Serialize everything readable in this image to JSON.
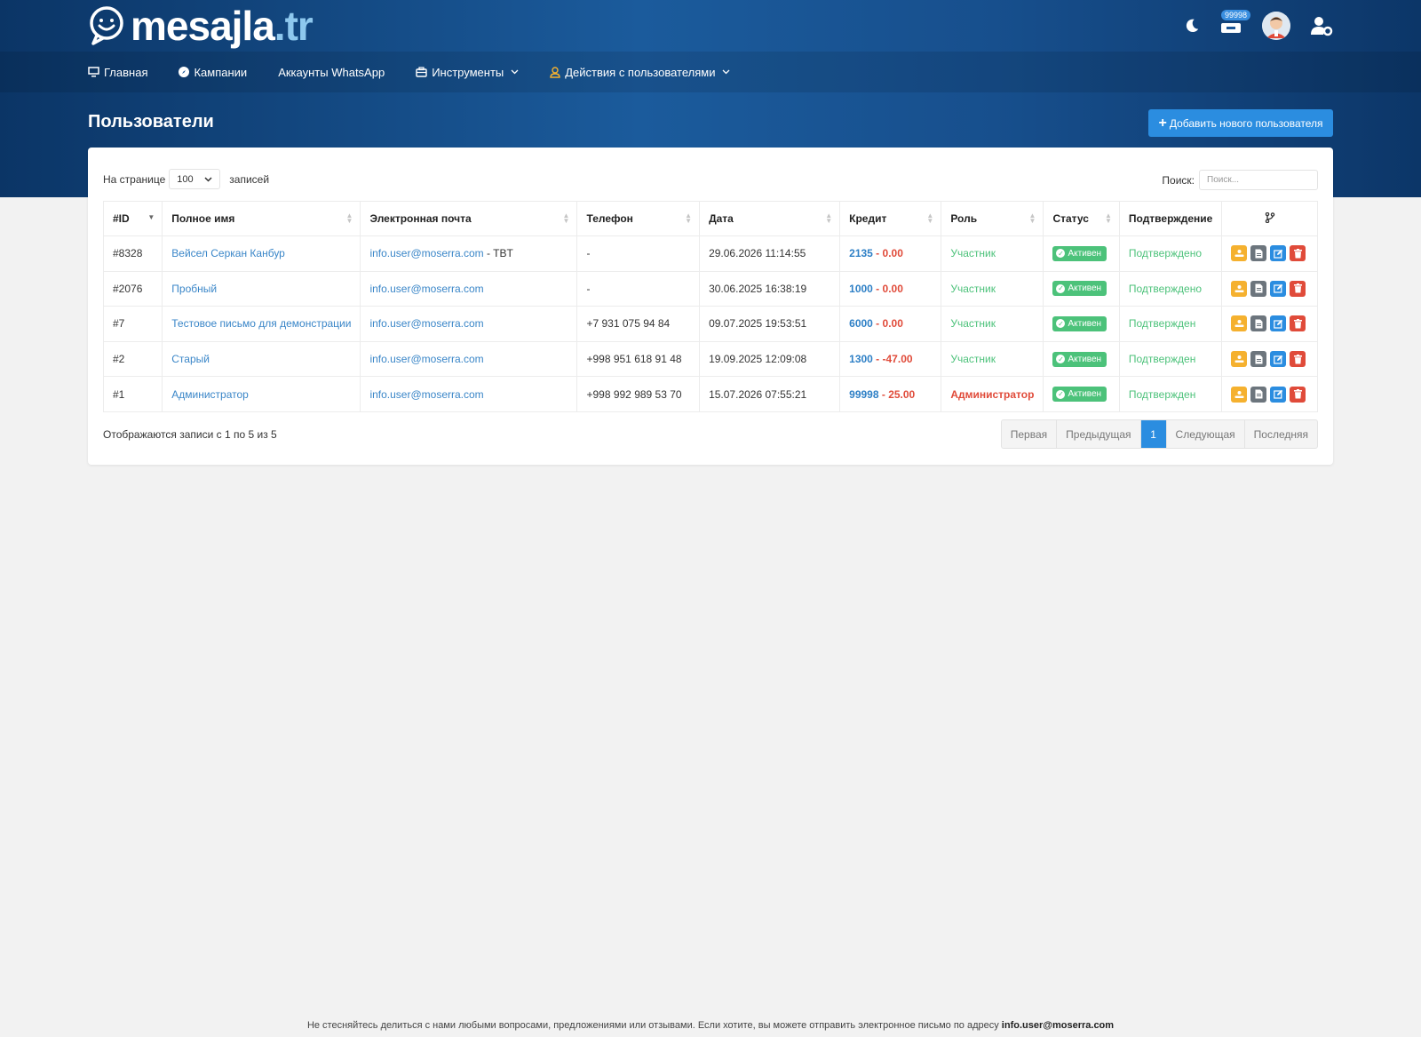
{
  "brand": {
    "name": "mesajla",
    "tld": ".tr"
  },
  "header": {
    "badge_count": "99998"
  },
  "nav": [
    {
      "label": "Главная",
      "icon": "monitor-icon"
    },
    {
      "label": "Кампании",
      "icon": "compass-icon"
    },
    {
      "label": "Аккаунты WhatsApp",
      "icon": ""
    },
    {
      "label": "Инструменты",
      "icon": "toolbox-icon",
      "dropdown": true
    },
    {
      "label": "Действия с пользователями",
      "icon": "user-icon",
      "dropdown": true
    }
  ],
  "page": {
    "title": "Пользователи",
    "add_button": "Добавить нового пользователя"
  },
  "length": {
    "prefix": "На странице",
    "value": "100",
    "suffix": "записей"
  },
  "search": {
    "label": "Поиск:",
    "placeholder": "Поиск..."
  },
  "table": {
    "columns": [
      "#ID",
      "Полное имя",
      "Электронная почта",
      "Телефон",
      "Дата",
      "Кредит",
      "Роль",
      "Статус",
      "Подтверждение"
    ],
    "rows": [
      {
        "id": "#8328",
        "name": "Вейсел Серкан Канбур",
        "email": "info.user@moserra.com",
        "email_suffix": " - TBT",
        "phone": "-",
        "date": "29.06.2026 11:14:55",
        "credit": "2135",
        "sep": " - ",
        "debt": "0.00",
        "role": "Участник",
        "status": "Активен",
        "confirm": "Подтверждено"
      },
      {
        "id": "#2076",
        "name": "Пробный",
        "email": "info.user@moserra.com",
        "email_suffix": "",
        "phone": "-",
        "date": "30.06.2025 16:38:19",
        "credit": "1000",
        "sep": " - ",
        "debt": "0.00",
        "role": "Участник",
        "status": "Активен",
        "confirm": "Подтверждено"
      },
      {
        "id": "#7",
        "name": "Тестовое письмо для демонстрации",
        "email": "info.user@moserra.com",
        "email_suffix": "",
        "phone": "+7 931 075 94 84",
        "date": "09.07.2025 19:53:51",
        "credit": "6000",
        "sep": " - ",
        "debt": "0.00",
        "role": "Участник",
        "status": "Активен",
        "confirm": "Подтвержден"
      },
      {
        "id": "#2",
        "name": "Старый",
        "email": "info.user@moserra.com",
        "email_suffix": "",
        "phone": "+998 951 618 91 48",
        "date": "19.09.2025 12:09:08",
        "credit": "1300",
        "sep": " - ",
        "debt": "-47.00",
        "role": "Участник",
        "status": "Активен",
        "confirm": "Подтвержден"
      },
      {
        "id": "#1",
        "name": "Администратор",
        "email": "info.user@moserra.com",
        "email_suffix": "",
        "phone": "+998 992 989 53 70",
        "date": "15.07.2026 07:55:21",
        "credit": "99998",
        "sep": " - ",
        "debt": "25.00",
        "role": "Администратор",
        "status": "Активен",
        "confirm": "Подтвержден"
      }
    ]
  },
  "info": "Отображаются записи с 1 по 5 из 5",
  "pagination": {
    "first": "Первая",
    "prev": "Предыдущая",
    "current": "1",
    "next": "Следующая",
    "last": "Последняя"
  },
  "footer": {
    "text": "Не стесняйтесь делиться с нами любыми вопросами, предложениями или отзывами. Если хотите, вы можете отправить электронное письмо по адресу ",
    "email": "info.user@moserra.com"
  },
  "colors": {
    "accent": "#2b8de0",
    "success": "#4cc27a",
    "danger": "#e04b3a",
    "warning": "#f5b12f"
  }
}
